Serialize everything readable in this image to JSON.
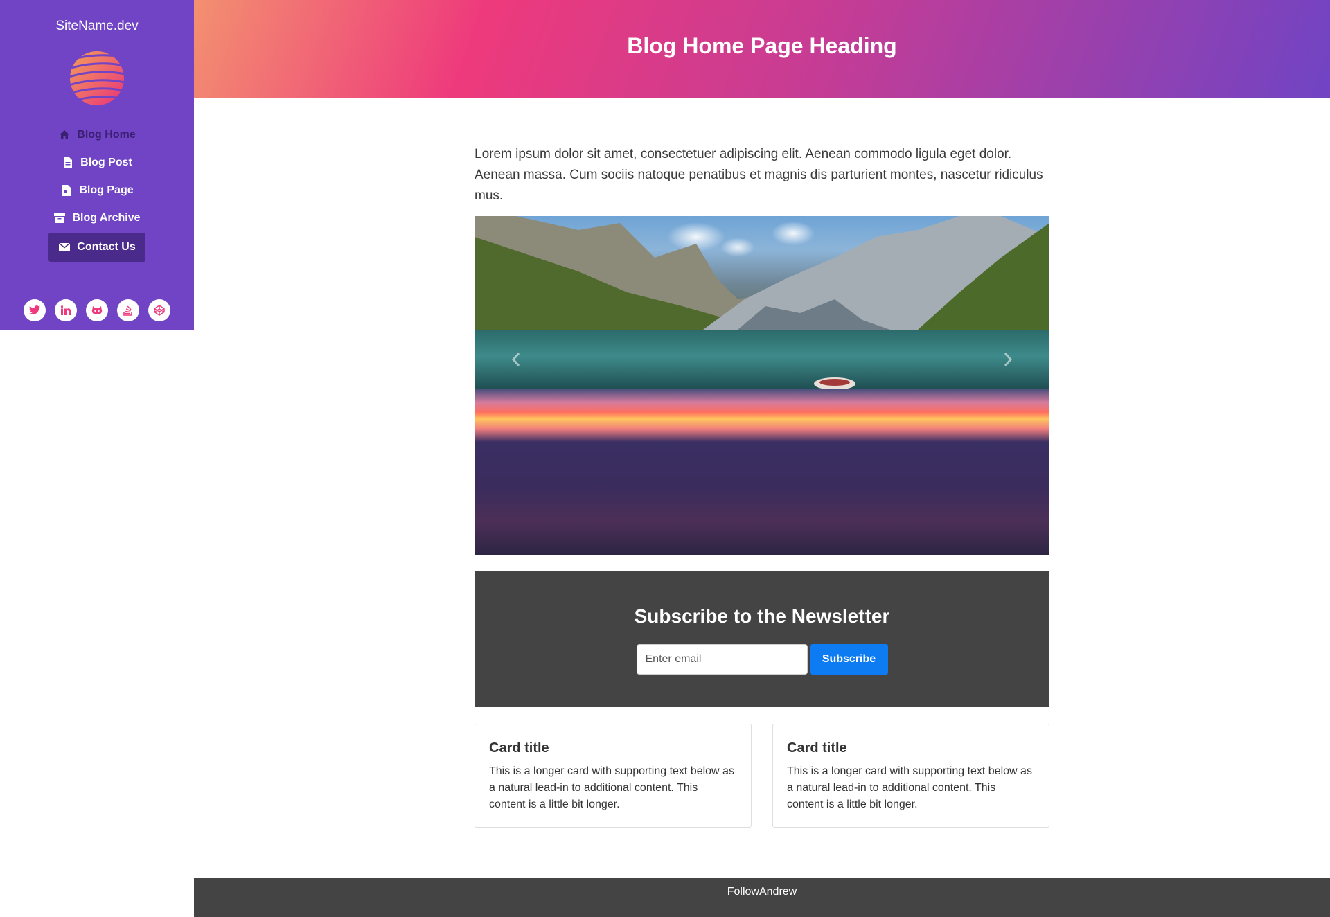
{
  "site": {
    "name": "SiteName.dev"
  },
  "nav": {
    "items": [
      {
        "label": "Blog Home",
        "icon": "home-icon"
      },
      {
        "label": "Blog Post",
        "icon": "document-icon"
      },
      {
        "label": "Blog Page",
        "icon": "document-icon"
      },
      {
        "label": "Blog Archive",
        "icon": "archive-icon"
      },
      {
        "label": "Contact Us",
        "icon": "envelope-icon"
      }
    ]
  },
  "social": [
    "twitter-icon",
    "linkedin-icon",
    "github-icon",
    "stackoverflow-icon",
    "codepen-icon"
  ],
  "header": {
    "title": "Blog Home Page Heading"
  },
  "main": {
    "intro": "Lorem ipsum dolor sit amet, consectetuer adipiscing elit. Aenean commodo ligula eget dolor. Aenean massa. Cum sociis natoque penatibus et magnis dis parturient montes, nascetur ridiculus mus."
  },
  "newsletter": {
    "title": "Subscribe to the Newsletter",
    "placeholder": "Enter email",
    "button": "Subscribe"
  },
  "cards": [
    {
      "title": "Card title",
      "text": "This is a longer card with supporting text below as a natural lead-in to additional content. This content is a little bit longer."
    },
    {
      "title": "Card title",
      "text": "This is a longer card with supporting text below as a natural lead-in to additional content. This content is a little bit longer."
    }
  ],
  "footer": {
    "text": "FollowAndrew"
  },
  "colors": {
    "sidebar": "#7044c4",
    "accent_pink": "#ee3a7c",
    "button_blue": "#0d7cf2",
    "dark_panel": "#444444"
  }
}
